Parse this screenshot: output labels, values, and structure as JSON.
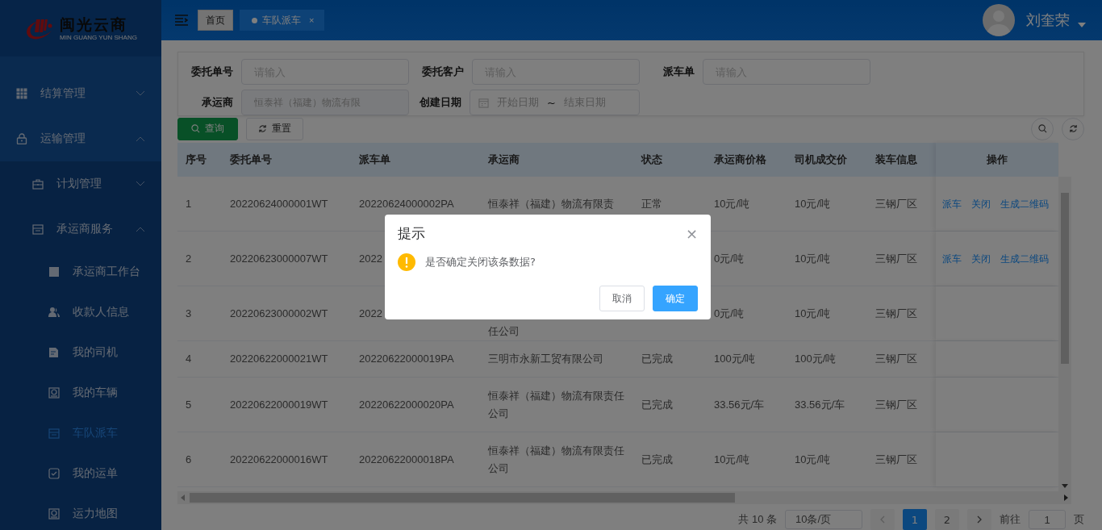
{
  "logo": {
    "title": "闽光云商",
    "subtitle": "MIN GUANG YUN SHANG"
  },
  "sidebar": {
    "items": [
      {
        "label": "结算管理",
        "expanded": false
      },
      {
        "label": "运输管理",
        "expanded": true,
        "children": [
          {
            "label": "计划管理",
            "expanded": false
          },
          {
            "label": "承运商服务",
            "expanded": true,
            "children": [
              {
                "label": "承运商工作台",
                "selected": false
              },
              {
                "label": "收款人信息",
                "selected": false
              },
              {
                "label": "我的司机",
                "selected": false
              },
              {
                "label": "我的车辆",
                "selected": false
              },
              {
                "label": "车队派车",
                "selected": true
              },
              {
                "label": "我的运单",
                "selected": false
              },
              {
                "label": "运力地图",
                "selected": false
              }
            ]
          }
        ]
      }
    ]
  },
  "tabs": [
    {
      "label": "首页",
      "selected": false,
      "closable": false
    },
    {
      "label": "车队派车",
      "selected": true,
      "closable": true,
      "close": "×"
    }
  ],
  "user": {
    "name": "刘奎荣"
  },
  "filters": [
    {
      "label": "委托单号",
      "placeholder": "请输入",
      "kind": "text"
    },
    {
      "label": "委托客户",
      "placeholder": "请输入",
      "kind": "text"
    },
    {
      "label": "派车单",
      "placeholder": "请输入",
      "kind": "text"
    },
    {
      "label": "承运商",
      "value": "恒泰祥（福建）物流有限",
      "kind": "text",
      "disabled": true
    },
    {
      "label": "创建日期",
      "kind": "daterange",
      "start_placeholder": "开始日期",
      "separator": "~",
      "end_placeholder": "结束日期"
    }
  ],
  "buttons": {
    "search": "查询",
    "reset": "重置"
  },
  "table": {
    "columns": [
      "序号",
      "委托单号",
      "派车单",
      "承运商",
      "状态",
      "承运商价格",
      "司机成交价",
      "装车信息",
      "操作"
    ],
    "rows": [
      {
        "cells": [
          "1",
          "20220624000001WT",
          "20220624000002PA",
          "恒泰祥（福建）物流有限责",
          "正常",
          "10元/吨",
          "10元/吨",
          "三钢厂区"
        ],
        "tall": true,
        "actions": [
          "派车",
          "关闭",
          "生成二维码"
        ]
      },
      {
        "cells": [
          "2",
          "20220623000007WT",
          "2022",
          "",
          "",
          "0元/吨",
          "10元/吨",
          "三钢厂区"
        ],
        "tall": true,
        "actions": [
          "派车",
          "关闭",
          "生成二维码"
        ]
      },
      {
        "cells": [
          "3",
          "20220623000002WT",
          "2022",
          "任公司",
          "",
          "0元/吨",
          "10元/吨",
          "三钢厂区"
        ],
        "tall": true,
        "continued": true,
        "actions": []
      },
      {
        "cells": [
          "4",
          "20220622000021WT",
          "20220622000019PA",
          "三明市永新工贸有限公司",
          "已完成",
          "100元/吨",
          "100元/吨",
          "三钢厂区"
        ],
        "tall": false,
        "actions": []
      },
      {
        "cells": [
          "5",
          "20220622000019WT",
          "20220622000020PA",
          "恒泰祥（福建）物流有限责任公司",
          "已完成",
          "33.56元/车",
          "33.56元/车",
          "三钢厂区"
        ],
        "tall": true,
        "actions": []
      },
      {
        "cells": [
          "6",
          "20220622000016WT",
          "20220622000018PA",
          "恒泰祥（福建）物流有限责任公司",
          "已完成",
          "10元/吨",
          "10元/吨",
          "三钢厂区"
        ],
        "tall": true,
        "actions": []
      }
    ]
  },
  "pagination": {
    "total": "共 10 条",
    "page_size": "10条/页",
    "pages": [
      {
        "label": "1",
        "selected": true
      },
      {
        "label": "2",
        "selected": false
      }
    ],
    "goto_label": "前往",
    "goto_value": "1",
    "goto_suffix": "页"
  },
  "dialog": {
    "title": "提示",
    "close": "×",
    "message": "是否确定关闭该条数据?",
    "cancel": "取消",
    "confirm": "确定"
  }
}
